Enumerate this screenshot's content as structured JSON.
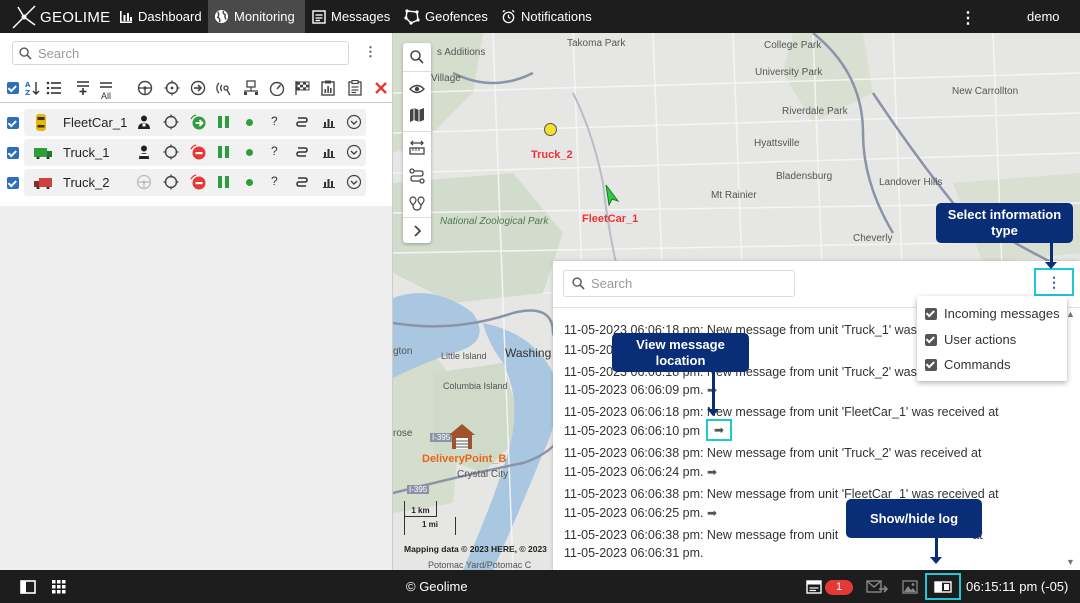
{
  "app": {
    "name": "GEOLIME",
    "user": "demo"
  },
  "nav": [
    {
      "label": "Dashboard",
      "icon": "bar-chart-icon",
      "active": false
    },
    {
      "label": "Monitoring",
      "icon": "globe-icon",
      "active": true
    },
    {
      "label": "Messages",
      "icon": "message-box-icon",
      "active": false
    },
    {
      "label": "Geofences",
      "icon": "geofence-icon",
      "active": false
    },
    {
      "label": "Notifications",
      "icon": "alarm-icon",
      "active": false
    }
  ],
  "left": {
    "search_placeholder": "Search",
    "units": [
      {
        "name": "FleetCar_1",
        "icon_color": "#e6b800",
        "status": "green"
      },
      {
        "name": "Truck_1",
        "icon_color": "#2e9e3d",
        "status": "red"
      },
      {
        "name": "Truck_2",
        "icon_color": "#d04040",
        "status": "red"
      }
    ],
    "toolbar_all_label": "All"
  },
  "map": {
    "labels": {
      "takoma_park": "Takoma Park",
      "college_park": "College Park",
      "university_park": "University Park",
      "riverdale_park": "Riverdale Park",
      "new_carrollton": "New Carrollton",
      "hyattsville": "Hyattsville",
      "bladensburg": "Bladensburg",
      "landover_hills": "Landover Hills",
      "mt_rainier": "Mt Rainier",
      "cheverly": "Cheverly",
      "national_zoo": "National Zoological Park",
      "washington": "Washing",
      "little_island": "Little Island",
      "columbia_island": "Columbia Island",
      "crystal_city": "Crystal City",
      "rosslyn": "rose",
      "arlington": "gton",
      "village": "Village",
      "s_additions": "s Additions",
      "potomac_yard": "Potomac Yard/Potomac C",
      "mapping_data": "Mapping data © 2023 HERE, © 2023",
      "scale_km": "1 km",
      "scale_mi": "1 mi",
      "i395_a": "I-395",
      "i395_b": "I-395"
    },
    "units": {
      "truck_2": "Truck_2",
      "fleetcar_1": "FleetCar_1",
      "delivery_point": "DeliveryPoint_B"
    }
  },
  "log": {
    "search_placeholder": "Search",
    "entries": [
      {
        "line1": "11-05-2023 06:06:18 pm: New message from unit 'Truck_1' was received at",
        "line2": "11-05-20"
      },
      {
        "line1": "11-05-2023 06:06:18 pm: New message from unit 'Truck_2' was received at",
        "line2": "11-05-2023 06:06:09 pm."
      },
      {
        "line1": "11-05-2023 06:06:18 pm: New message from unit 'FleetCar_1' was received at",
        "line2": "11-05-2023 06:06:10 pm"
      },
      {
        "line1": "11-05-2023 06:06:38 pm: New message from unit 'Truck_2' was received at",
        "line2": "11-05-2023 06:06:24 pm."
      },
      {
        "line1": "11-05-2023 06:06:38 pm: New message from unit 'FleetCar_1' was received at",
        "line2": "11-05-2023 06:06:25 pm."
      },
      {
        "line1": "11-05-2023 06:06:38 pm: New message from unit",
        "line1b": "at",
        "line2": "11-05-2023 06:06:31 pm."
      }
    ],
    "info_types": [
      {
        "label": "Incoming messages",
        "checked": true
      },
      {
        "label": "User actions",
        "checked": true
      },
      {
        "label": "Commands",
        "checked": true
      }
    ]
  },
  "callouts": {
    "select_info": "Select information type",
    "view_message": "View message location",
    "show_hide_log": "Show/hide log"
  },
  "bottom": {
    "copyright": "© Geolime",
    "notification_count": "1",
    "clock": "06:15:11 pm (-05)"
  }
}
